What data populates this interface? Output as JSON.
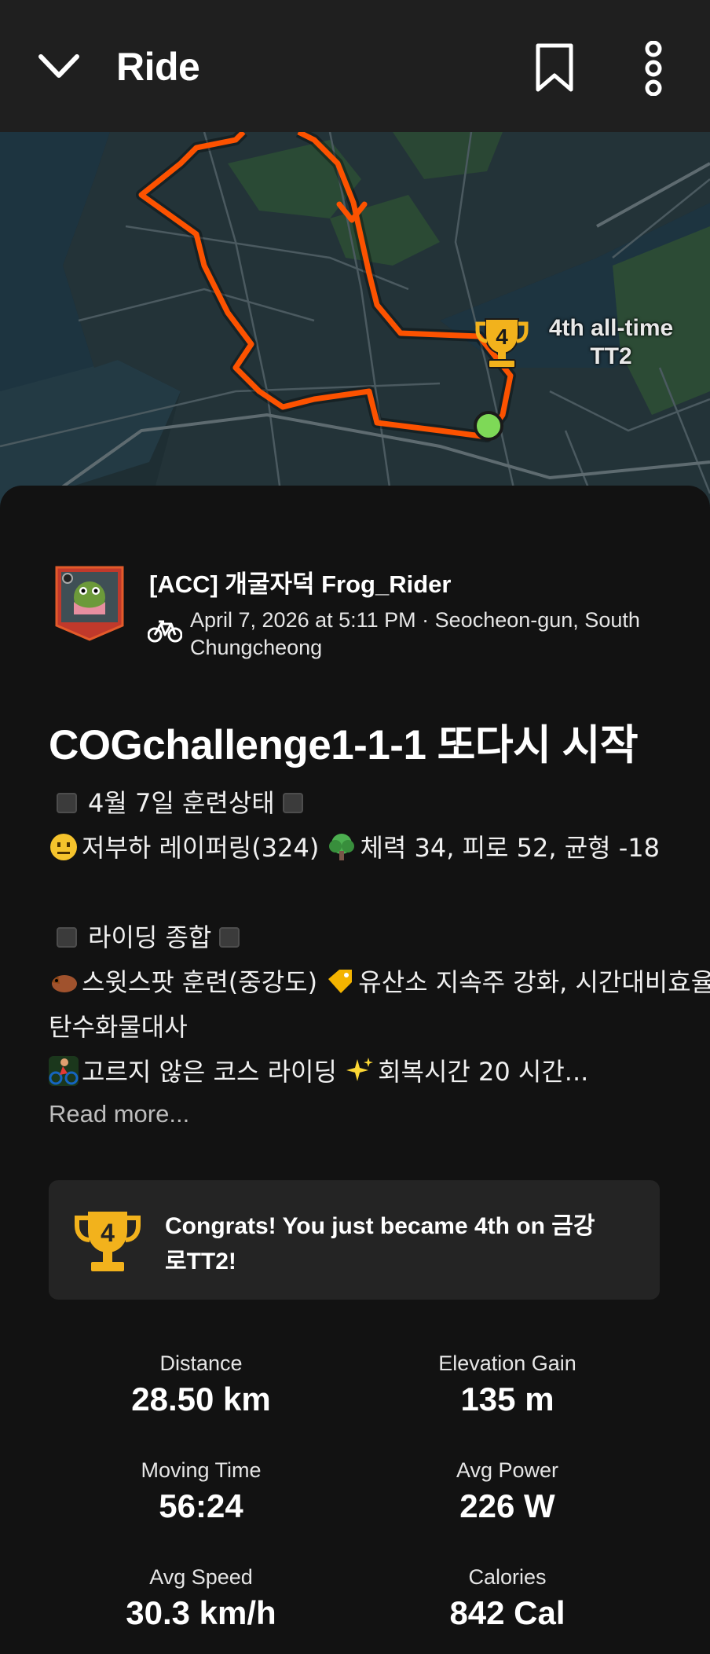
{
  "header": {
    "title": "Ride",
    "back_icon": "chevron-down-icon",
    "bookmark_icon": "bookmark-icon",
    "more_icon": "more-vertical-icon"
  },
  "map": {
    "segment_label_line1": "4th all-time",
    "segment_label_line2": "TT2",
    "route_color": "#fc5200",
    "rank_number": "4"
  },
  "athlete": {
    "name": "[ACC] 개굴자덕 Frog_Rider",
    "meta": "April 7, 2026 at 5:11 PM · Seocheon-gun, South Chungcheong"
  },
  "activity": {
    "title": "COGchallenge1-1-1 또다시 시작",
    "desc": {
      "heading1": "4월 7일 훈련상태",
      "line2_a": "저부하 레이퍼링(324)",
      "line2_b": "체력 34, 피로 52, 균형 -18",
      "heading2": "라이딩 종합",
      "line4_a": "스윗스팟 훈련(중강도)",
      "line4_b": "유산소 지속주 강화, 시간대비효율,",
      "line5": "탄수화물대사",
      "line6_a": "고르지 않은 코스 라이딩",
      "line6_b": "회복시간 20 시간..."
    },
    "read_more": "Read more..."
  },
  "congrats": {
    "text": "Congrats! You just became 4th on 금강로TT2!",
    "rank": "4"
  },
  "stats": [
    {
      "label": "Distance",
      "value": "28.50 km"
    },
    {
      "label": "Elevation Gain",
      "value": "135 m"
    },
    {
      "label": "Moving Time",
      "value": "56:24"
    },
    {
      "label": "Avg Power",
      "value": "226 W"
    },
    {
      "label": "Avg Speed",
      "value": "30.3 km/h"
    },
    {
      "label": "Calories",
      "value": "842 Cal"
    }
  ],
  "colors": {
    "accent": "#fc5200",
    "trophy": "#f2b21c",
    "start_dot": "#7ed957"
  }
}
